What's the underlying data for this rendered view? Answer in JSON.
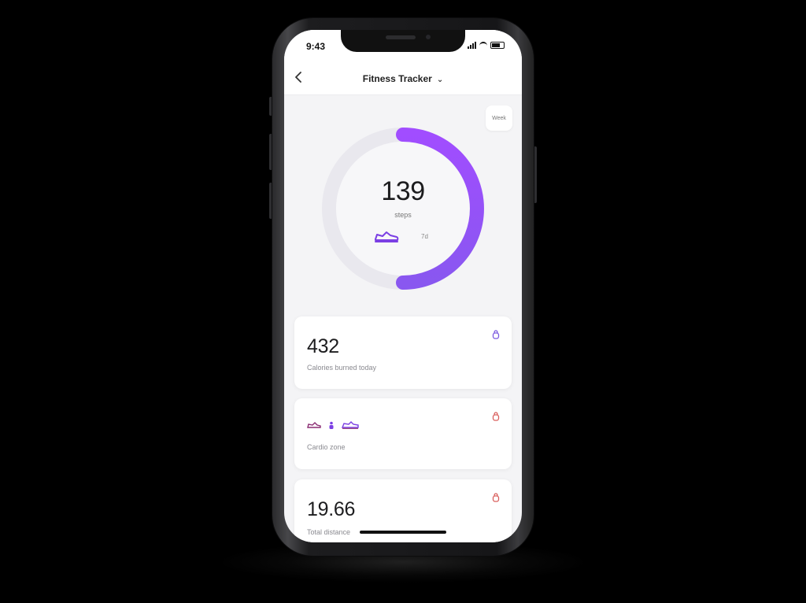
{
  "status_bar": {
    "time": "9:43"
  },
  "nav": {
    "title": "Fitness Tracker"
  },
  "chip": {
    "label": "Week"
  },
  "steps": {
    "count": "139",
    "label": "steps",
    "meta": "7d",
    "progress": 0.5
  },
  "cards": [
    {
      "value": "432",
      "label": "Calories burned today"
    },
    {
      "value": "",
      "label": "Cardio zone"
    },
    {
      "value": "19.66",
      "label": "Total distance"
    }
  ],
  "icons": {
    "back": "chevron-left-icon",
    "dropdown": "chevron-down-icon",
    "shoe": "sneaker-icon",
    "card1": "kettlebell-icon",
    "card2": "kettlebell-icon",
    "card3": "kettlebell-icon"
  },
  "colors": {
    "accent": "#9b4dff",
    "accent_deep": "#7b3fe4",
    "ring_track": "#e9e8ee",
    "card_icon_purple": "#7c5be0",
    "card_icon_red": "#d9605e"
  }
}
